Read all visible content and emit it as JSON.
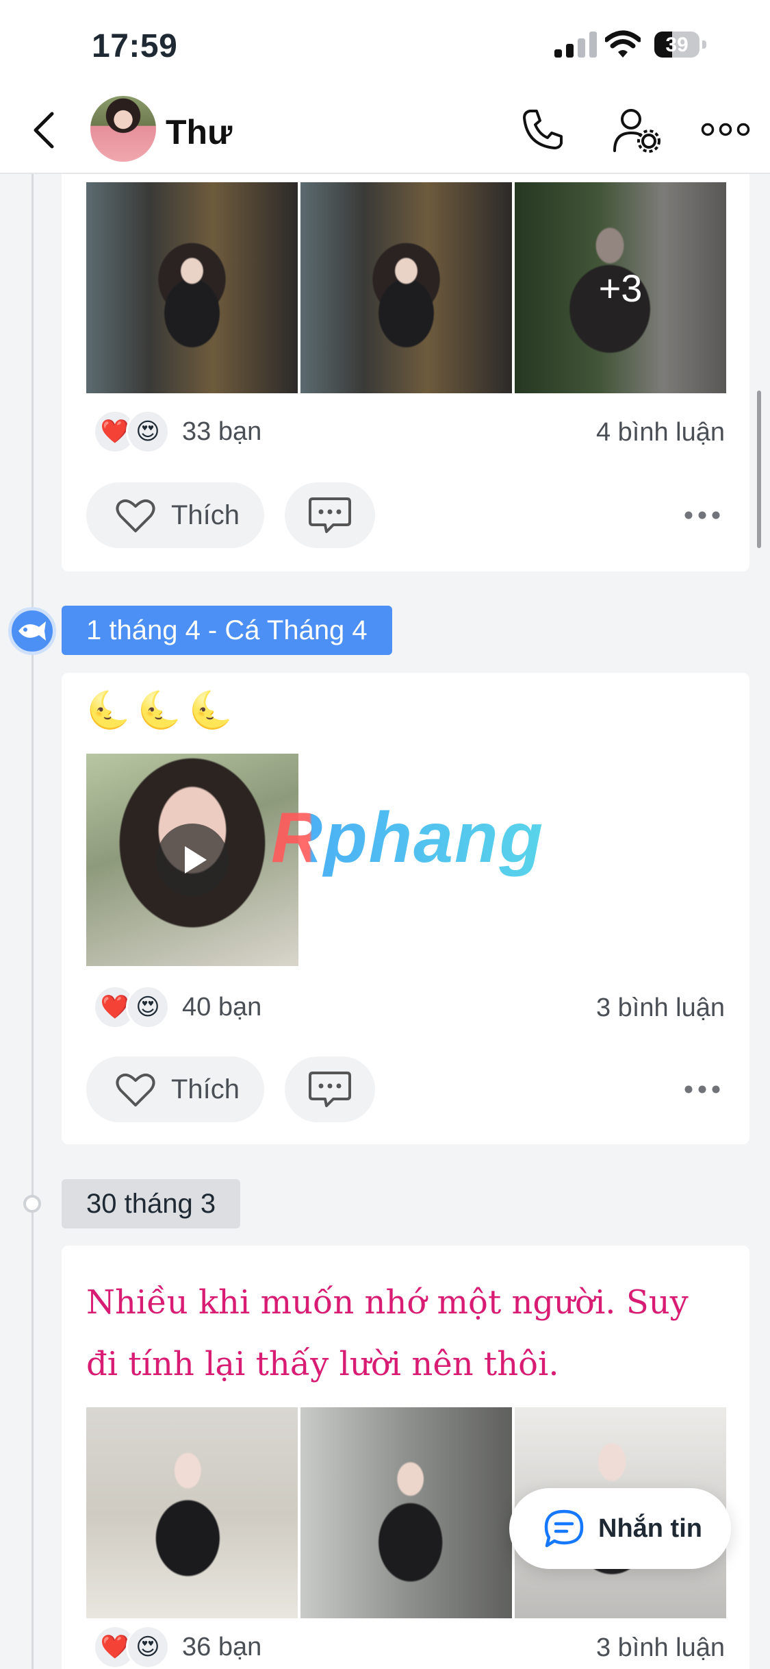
{
  "status_bar": {
    "time": "17:59",
    "battery": "39",
    "battery_level": 0.39
  },
  "header": {
    "contact_name": "Thư"
  },
  "timeline": {
    "posts": [
      {
        "photo_more_label": "+3",
        "reactions": {
          "icons": [
            "❤️",
            "😍"
          ],
          "count_label": "33 bạn"
        },
        "comments_label": "4 bình luận",
        "like_label": "Thích"
      },
      {
        "date_label": "1 tháng 4 - Cá Tháng 4",
        "emojis": [
          "🌜",
          "🌜",
          "🌜"
        ],
        "reactions": {
          "icons": [
            "❤️",
            "😍"
          ],
          "count_label": "40 bạn"
        },
        "comments_label": "3 bình luận",
        "like_label": "Thích"
      },
      {
        "date_label": "30 tháng 3",
        "text": "Nhiều khi muốn nhớ một người. Suy đi tính lại thấy lười nên thôi.",
        "reactions": {
          "icons": [
            "❤️",
            "😍"
          ],
          "count_label": "36 bạn"
        },
        "comments_label": "3 bình luận"
      }
    ]
  },
  "watermark": "Rphang",
  "message_button": {
    "label": "Nhắn tin"
  },
  "colors": {
    "accent_blue": "#4c8ff5",
    "quote_pink": "#d81b73"
  }
}
